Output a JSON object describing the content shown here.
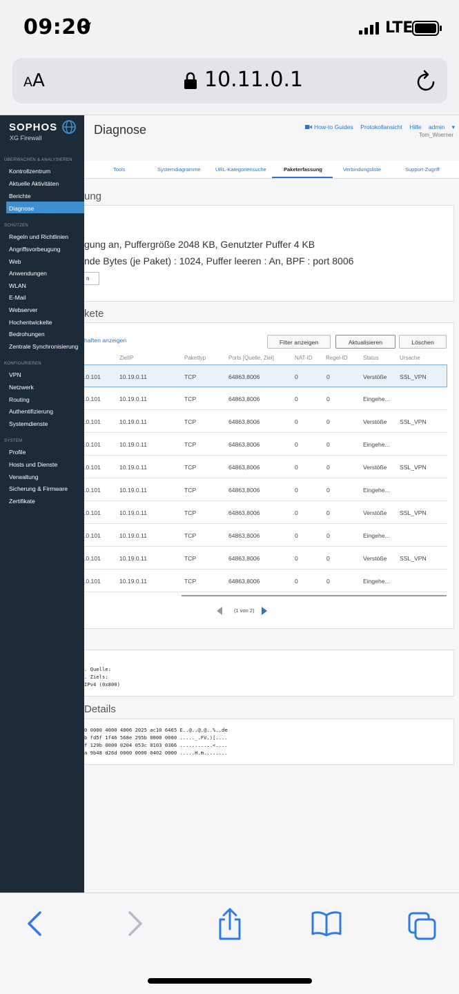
{
  "ios": {
    "time": "09:20",
    "network": "LTE",
    "text_size_label_small": "A",
    "text_size_label_big": "A",
    "url": "10.11.0.1"
  },
  "brand": {
    "logo": "SOPHOS",
    "product": "XG Firewall"
  },
  "sidebar": {
    "sections": [
      {
        "title": "ÜBERWACHEN & ANALYSIEREN",
        "items": [
          "Kontrollzentrum",
          "Aktuelle Aktivitäten",
          "Berichte",
          "Diagnose"
        ]
      },
      {
        "title": "SCHÜTZEN",
        "items": [
          "Regeln und Richtlinien",
          "Angriffsvorbeugung",
          "Web",
          "Anwendungen",
          "WLAN",
          "E-Mail",
          "Webserver",
          "Hochentwickelte",
          "Bedrohungen",
          "Zentrale Synchronisierung"
        ]
      },
      {
        "title": "KONFIGURIEREN",
        "items": [
          "VPN",
          "Netzwerk",
          "Routing",
          "Authentifizierung",
          "Systemdienste"
        ]
      },
      {
        "title": "SYSTEM",
        "items": [
          "Profile",
          "Hosts und Dienste",
          "Verwaltung",
          "Sicherung & Firmware",
          "Zertifikate"
        ]
      }
    ],
    "active": "Diagnose"
  },
  "header": {
    "title": "Diagnose",
    "links": [
      "How-to Guides",
      "Protokollansicht",
      "Hilfe",
      "admin"
    ],
    "user": "Tom_Woerner"
  },
  "tabs": [
    "Tools",
    "Systemdiagramme",
    "URL-Kategoriensuche",
    "Paketerfassung",
    "Verbindungsliste",
    "Support-Zugriff"
  ],
  "active_tab": "Paketerfassung",
  "capture": {
    "section_title": "ung",
    "line1": "gung an, Puffergröße 2048 KB, Genutzter Puffer 4 KB",
    "line2": "nde Bytes (je Paket) : 1024, Puffer leeren : An, BPF : port 8006",
    "button": "n"
  },
  "packets": {
    "section_title": "kete",
    "props_link": "haften anzeigen",
    "buttons": {
      "filter": "Filter anzeigen",
      "refresh": "Aktualisieren",
      "clear": "Löschen"
    },
    "columns": [
      "ZielIP",
      "Pakettyp",
      "Ports [Quelle, Ziel]",
      "NAT-ID",
      "Regel-ID",
      "Status",
      "Ursache"
    ],
    "rows": [
      {
        "src": ".0.101",
        "dst": "10.19.0.11",
        "type": "TCP",
        "ports": "64863,8006",
        "nat": "0",
        "rule": "0",
        "status": "Verstöße",
        "reason": "SSL_VPN"
      },
      {
        "src": ".0.101",
        "dst": "10.19.0.11",
        "type": "TCP",
        "ports": "64863,8006",
        "nat": "0",
        "rule": "0",
        "status": "Eingehe...",
        "reason": ""
      },
      {
        "src": ".0.101",
        "dst": "10.19.0.11",
        "type": "TCP",
        "ports": "64863,8006",
        "nat": "0",
        "rule": "0",
        "status": "Verstöße",
        "reason": "SSL_VPN"
      },
      {
        "src": ".0.101",
        "dst": "10.19.0.11",
        "type": "TCP",
        "ports": "64863,8006",
        "nat": "0",
        "rule": "0",
        "status": "Eingehe...",
        "reason": ""
      },
      {
        "src": ".0.101",
        "dst": "10.19.0.11",
        "type": "TCP",
        "ports": "64863,8006",
        "nat": "0",
        "rule": "0",
        "status": "Verstöße",
        "reason": "SSL_VPN"
      },
      {
        "src": ".0.101",
        "dst": "10.19.0.11",
        "type": "TCP",
        "ports": "64863,8006",
        "nat": "0",
        "rule": "0",
        "status": "Eingehe...",
        "reason": ""
      },
      {
        "src": ".0.101",
        "dst": "10.19.0.11",
        "type": "TCP",
        "ports": "64863,8006",
        "nat": "0",
        "rule": "0",
        "status": "Verstöße",
        "reason": "SSL_VPN"
      },
      {
        "src": ".0.101",
        "dst": "10.19.0.11",
        "type": "TCP",
        "ports": "64863,8006",
        "nat": "0",
        "rule": "0",
        "status": "Eingehe...",
        "reason": ""
      },
      {
        "src": ".0.101",
        "dst": "10.19.0.11",
        "type": "TCP",
        "ports": "64863,8006",
        "nat": "0",
        "rule": "0",
        "status": "Verstöße",
        "reason": "SSL_VPN"
      },
      {
        "src": ".0.101",
        "dst": "10.19.0.11",
        "type": "TCP",
        "ports": "64863,8006",
        "nat": "0",
        "rule": "0",
        "status": "Eingehe...",
        "reason": ""
      }
    ],
    "pager": "(1 von 2)"
  },
  "info_lines": [
    ". Quelle:",
    ". Ziels:",
    "IPv4 (0x800)"
  ],
  "details": {
    "section_title": "Details",
    "hex_lines": [
      "0 0000 4000 4006 2025 ac10 6465 E..@..@.@..%..de",
      "b fd5f 1f46 568e 295b 0000 0000 ....._.FV.)[....",
      "f 129b 0000 0204 053c 0103 0306 ...........<....",
      "a 9b48 d26d 0000 0000 0402 0000 .....H.m........"
    ]
  },
  "colors": {
    "sidebar": "#1b2b38",
    "accent": "#3f8fd0",
    "link": "#2c76c3",
    "toolbar_icon": "#2f7ae5"
  }
}
